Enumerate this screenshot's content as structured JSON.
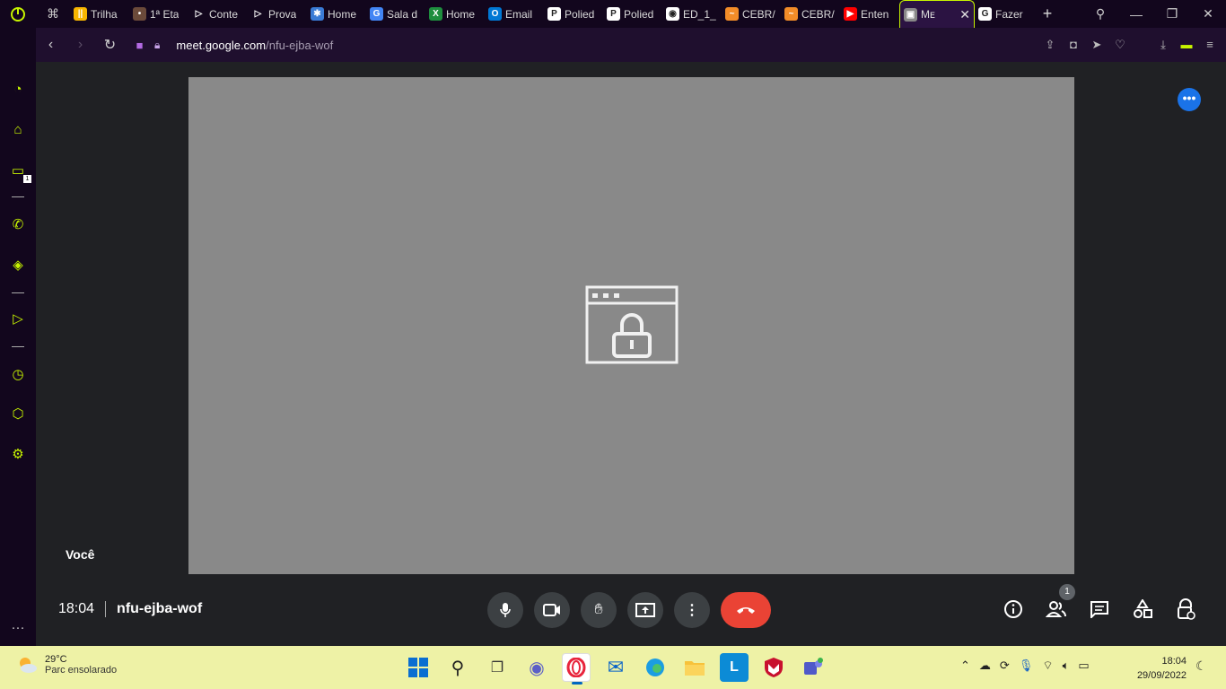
{
  "tabs": [
    {
      "title": "Trilha",
      "fav_color": "#f7b500",
      "fav_glyph": "||"
    },
    {
      "title": "1ª Eta",
      "fav_color": "#6b4a3a",
      "fav_glyph": "•"
    },
    {
      "title": "Conte",
      "fav_color": "#12061d",
      "fav_glyph": "▷"
    },
    {
      "title": "Prova",
      "fav_color": "#12061d",
      "fav_glyph": "▷"
    },
    {
      "title": "Home",
      "fav_color": "#3a7bd5",
      "fav_glyph": "✱"
    },
    {
      "title": "Sala d",
      "fav_color": "#4285f4",
      "fav_glyph": "G"
    },
    {
      "title": "Home",
      "fav_color": "#1e8e3e",
      "fav_glyph": "X"
    },
    {
      "title": "Email",
      "fav_color": "#0078d4",
      "fav_glyph": "O"
    },
    {
      "title": "Polied",
      "fav_color": "#ffffff",
      "fav_glyph": "P"
    },
    {
      "title": "Polied",
      "fav_color": "#ffffff",
      "fav_glyph": "P"
    },
    {
      "title": "ED_1_",
      "fav_color": "#ffffff",
      "fav_glyph": "◉"
    },
    {
      "title": "CEBR/",
      "fav_color": "#f28c28",
      "fav_glyph": "~"
    },
    {
      "title": "CEBR/",
      "fav_color": "#f28c28",
      "fav_glyph": "~"
    },
    {
      "title": "Enten",
      "fav_color": "#ff0000",
      "fav_glyph": "▶"
    },
    {
      "title": "Mᴇ",
      "fav_color": "#888888",
      "fav_glyph": "▣",
      "active": true
    },
    {
      "title": "Fazer",
      "fav_color": "#ffffff",
      "fav_glyph": "G"
    }
  ],
  "address": {
    "url_host": "meet.google.com",
    "url_path": "/nfu-ejba-wof"
  },
  "meeting": {
    "participant_label": "Você",
    "time": "18:04",
    "code": "nfu-ejba-wof",
    "participants_count": "1"
  },
  "taskbar": {
    "temperature": "29°C",
    "weather_desc": "Parc ensolarado",
    "time": "18:04",
    "date": "29/09/2022"
  },
  "sidebar": {
    "notification_count": "1"
  },
  "colors": {
    "accent": "#c7f400",
    "end_call": "#ea4335",
    "fab": "#1a73e8",
    "video_bg": "#898989"
  }
}
